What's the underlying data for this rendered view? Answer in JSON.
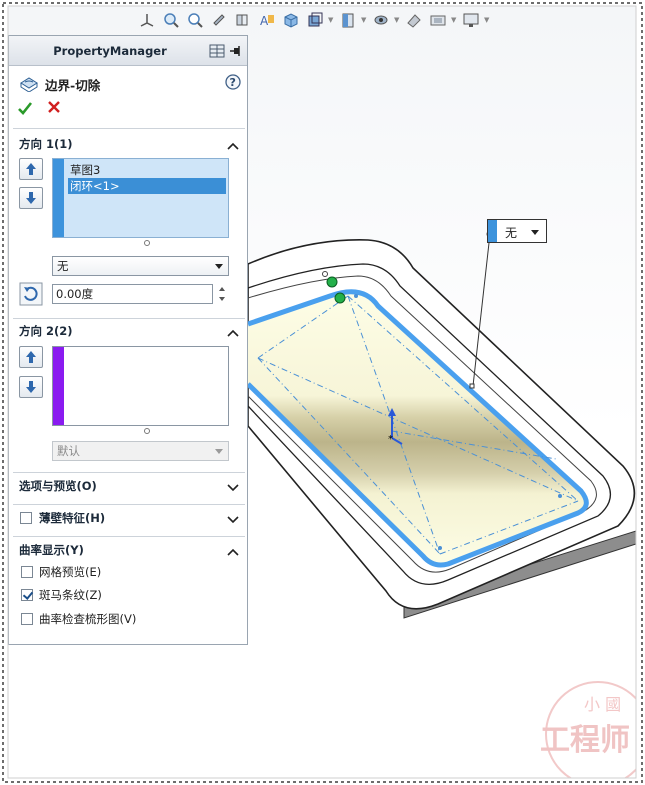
{
  "property_manager": {
    "header_title": "PropertyManager",
    "feature_title": "边界-切除",
    "direction1": {
      "label": "方向 1(1)",
      "items": [
        "草图3",
        "闭环<1>"
      ],
      "selected_index": 1,
      "tangent_type": "无",
      "draft_angle": "0.00度"
    },
    "direction2": {
      "label": "方向 2(2)",
      "items": [],
      "tangent_type": "默认"
    },
    "options_preview": {
      "label": "选项与预览(O)"
    },
    "thin_feature": {
      "label": "薄壁特征(H)",
      "checked": false
    },
    "curvature_display": {
      "label": "曲率显示(Y)",
      "mesh_preview": {
        "label": "网格预览(E)",
        "checked": false
      },
      "zebra_stripes": {
        "label": "斑马条纹(Z)",
        "checked": true
      },
      "curvature_combs": {
        "label": "曲率检查梳形图(V)",
        "checked": false
      }
    }
  },
  "viewport": {
    "callout_value": "无"
  },
  "watermark": {
    "top_text": "小 國",
    "main_text": "工程师"
  },
  "colors": {
    "selection_blue": "#3d93dc",
    "direction2_purple": "#8a1bf0",
    "ok_green": "#2a9a2a",
    "cancel_red": "#d11f1f"
  }
}
